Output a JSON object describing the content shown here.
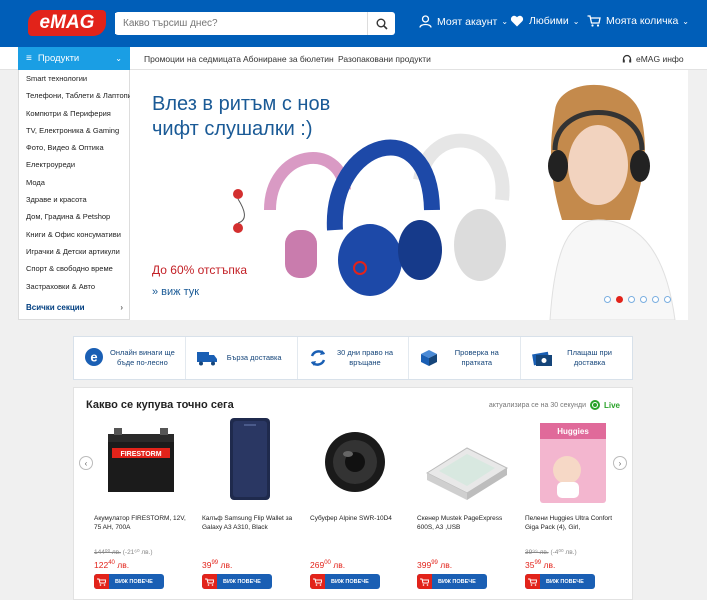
{
  "header": {
    "logo": "eMAG",
    "search_placeholder": "Какво търсиш днес?",
    "account": "Моят акаунт",
    "favorites": "Любими",
    "cart": "Моята количка"
  },
  "subnav": {
    "products": "Продукти",
    "links": [
      "Промоции на седмицата",
      "Абониране за бюлетин",
      "Разопаковани продукти"
    ],
    "info": "eMAG инфо"
  },
  "categories": [
    "Smart технологии",
    "Телефони, Таблети & Лаптопи",
    "Компютри & Периферия",
    "TV, Електроника & Gaming",
    "Фото, Видео & Оптика",
    "Електроуреди",
    "Мода",
    "Здраве и красота",
    "Дом, Градина & Petshop",
    "Книги & Офис консумативи",
    "Играчки & Детски артикули",
    "Спорт & свободно време",
    "Застраховки & Авто"
  ],
  "all_sections": "Всички секции",
  "banner": {
    "line1": "Влез в ритъм с нов",
    "line2": "чифт слушалки :)",
    "discount": "До 60% отстъпка",
    "more": "» виж тук",
    "slides": 6,
    "active_slide": 2
  },
  "features": [
    {
      "icon": "emag-e-icon",
      "text": "Онлайн винаги ще бъде по-лесно"
    },
    {
      "icon": "truck-icon",
      "text": "Бърза доставка"
    },
    {
      "icon": "return-arrows-icon",
      "text": "30 дни право на връщане"
    },
    {
      "icon": "box-icon",
      "text": "Проверка на пратката"
    },
    {
      "icon": "cash-icon",
      "text": "Плащаш при доставка"
    }
  ],
  "trending": {
    "title": "Какво се купува точно сега",
    "refresh": "актуализира се на 30 секунди",
    "live": "Live",
    "button_label": "ВИЖ ПОВЕЧЕ",
    "products": [
      {
        "name": "Акумулатор FIRESTORM, 12V, 75 AH, 700A",
        "old": "144⁰⁰ лв.",
        "disc": "(-21⁶⁰ лв.)",
        "price": "122",
        "cents": "40",
        "cur": "лв.",
        "img_label": "FIRESTORM"
      },
      {
        "name": "Калъф Samsung Flip Wallet за Galaxy A3 A310, Black",
        "old": "",
        "disc": "",
        "price": "39",
        "cents": "99",
        "cur": "лв.",
        "img_label": ""
      },
      {
        "name": "Субуфер Alpine SWR-10D4",
        "old": "",
        "disc": "",
        "price": "269",
        "cents": "00",
        "cur": "лв.",
        "img_label": ""
      },
      {
        "name": "Скенер Mustek PageExpress 600S, A3 ,USB",
        "old": "",
        "disc": "",
        "price": "399",
        "cents": "99",
        "cur": "лв.",
        "img_label": ""
      },
      {
        "name": "Пелени Huggies Ultra Confort Giga Pack (4), Girl,",
        "old": "39⁹⁹ лв.",
        "disc": "(-4⁰⁰ лв.)",
        "price": "35",
        "cents": "99",
        "cur": "лв.",
        "img_label": "Huggies"
      }
    ]
  },
  "colors": {
    "brand_blue": "#005eb8",
    "accent_red": "#e2231a",
    "menu_blue": "#1a9ee4",
    "live_green": "#29a329"
  }
}
